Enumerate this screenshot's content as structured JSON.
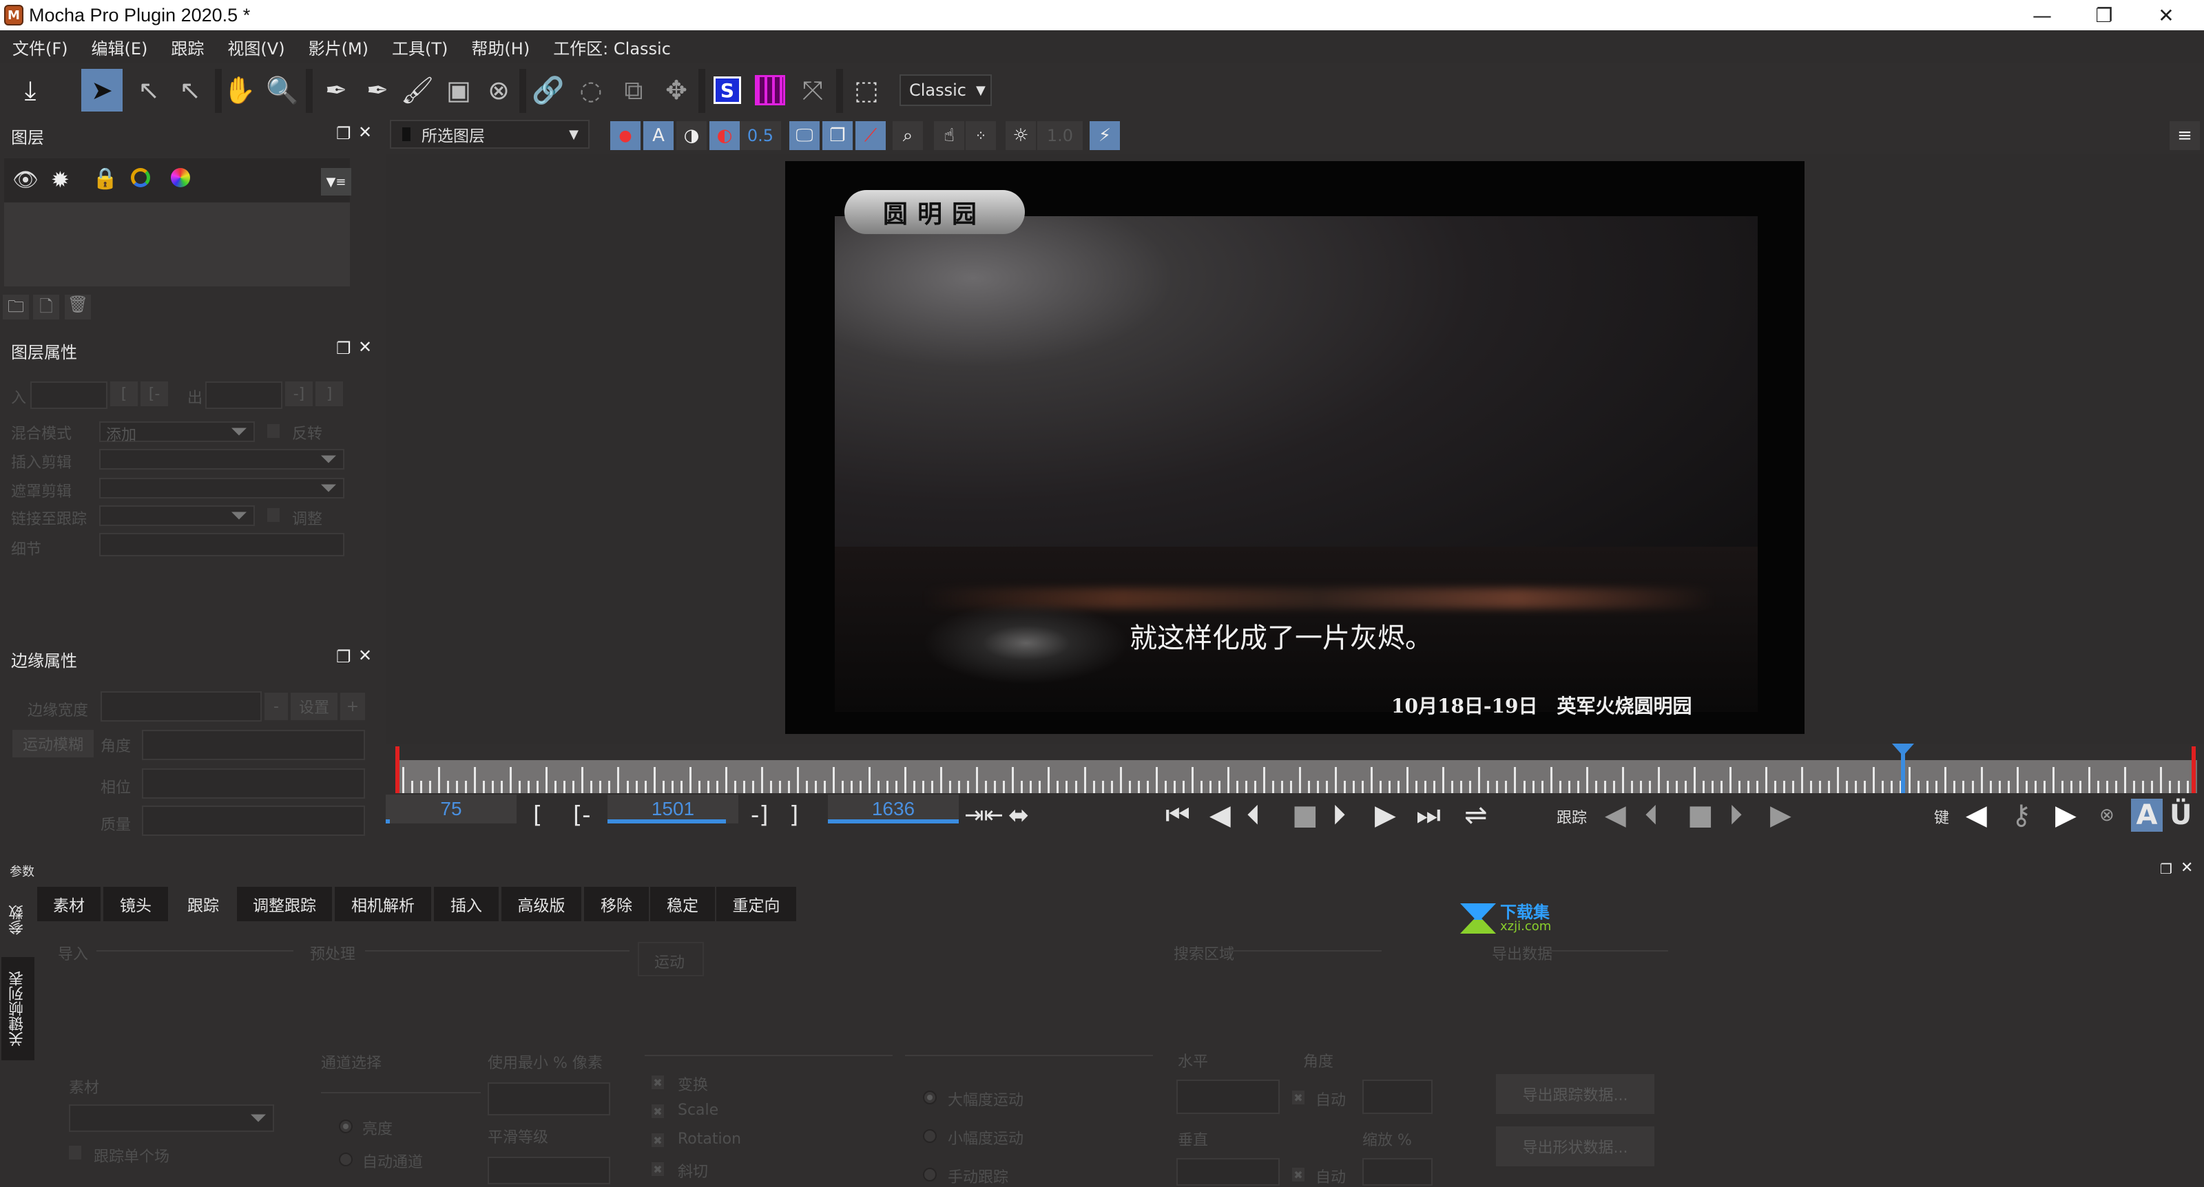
{
  "window": {
    "title": "Mocha Pro Plugin 2020.5 *",
    "logo_letter": "M",
    "minimize": "—",
    "restore": "❐",
    "close": "✕"
  },
  "menu": [
    "文件(F)",
    "编辑(E)",
    "跟踪",
    "视图(V)",
    "影片(M)",
    "工具(T)",
    "帮助(H)",
    "工作区: Classic"
  ],
  "toolbar": {
    "workspace_dropdown": "Classic",
    "tools": [
      {
        "name": "import-icon",
        "glyph": "⤓"
      },
      {
        "name": "select-pointer-icon",
        "glyph": "➤",
        "active": true
      },
      {
        "name": "select-bezier-icon",
        "glyph": "↖"
      },
      {
        "name": "add-point-icon",
        "glyph": "↖"
      },
      {
        "name": "pan-hand-icon",
        "glyph": "✋"
      },
      {
        "name": "zoom-icon",
        "glyph": "🔍"
      },
      {
        "name": "pen-xspline-icon",
        "glyph": "✒"
      },
      {
        "name": "pen-magnetic-icon",
        "glyph": "✒"
      },
      {
        "name": "brush-icon",
        "glyph": "🖌"
      },
      {
        "name": "rect-xspline-icon",
        "glyph": "▣"
      },
      {
        "name": "ellipse-xspline-icon",
        "glyph": "⊗"
      },
      {
        "name": "link-icon",
        "glyph": "🔗"
      },
      {
        "name": "rotate-icon",
        "glyph": "◌"
      },
      {
        "name": "scale-icon",
        "glyph": "⧉"
      },
      {
        "name": "move-icon",
        "glyph": "✥"
      },
      {
        "name": "surface-icon",
        "glyph": "S"
      },
      {
        "name": "grid-icon",
        "glyph": "▦"
      },
      {
        "name": "align-surface-icon",
        "glyph": "⤧"
      },
      {
        "name": "select-region-icon",
        "glyph": "⬚"
      }
    ]
  },
  "viewer_toolbar": {
    "layer_select": "所选图层",
    "opacity": "0.5",
    "brightness": "1.0"
  },
  "layers_panel": {
    "title": "图层",
    "menu_icon": "▼≡"
  },
  "layer_props": {
    "title": "图层属性",
    "in_label": "入",
    "out_label": "出",
    "blend_label": "混合模式",
    "blend_value": "添加",
    "invert_label": "反转",
    "insert_clip_label": "插入剪辑",
    "matte_clip_label": "遮罩剪辑",
    "link_track_label": "链接至跟踪",
    "adjust_label": "调整",
    "detail_label": "细节"
  },
  "edge_props": {
    "title": "边缘属性",
    "width_label": "边缘宽度",
    "minus": "-",
    "set": "设置",
    "plus": "+",
    "motion_blur": "运动模糊",
    "angle_label": "角度",
    "phase_label": "相位",
    "quality_label": "质量"
  },
  "frame": {
    "badge": "圆明园",
    "subtitle": "就这样化成了一片灰烬。",
    "caption": "10月18日-19日　英军火烧圆明园"
  },
  "timeline": {
    "current_frame": "75",
    "in_point": "1501",
    "out_point": "1636",
    "playhead_fraction": 0.838,
    "bracket_in": "[",
    "bracket_in2": "[-",
    "bracket_out2": "-]",
    "bracket_out": "]",
    "track_label": "跟踪",
    "key_label": "键"
  },
  "params": {
    "panel_title": "参数",
    "side_tabs": [
      "参数",
      "关键帧列表"
    ],
    "tabs": [
      "素材",
      "镜头",
      "跟踪",
      "调整跟踪",
      "相机解析",
      "插入",
      "高级版",
      "移除",
      "稳定",
      "重定向"
    ],
    "active_tab": 2,
    "input_section": "导入",
    "clip_label": "素材",
    "track_single_field": "跟踪单个场",
    "preprocess_section": "预处理",
    "channel_label": "通道选择",
    "channel_luminance": "亮度",
    "channel_auto": "自动通道",
    "min_pixels_label": "使用最小 % 像素",
    "smoothing_label": "平滑等级",
    "motion_section": "运动",
    "motion_checks": [
      "变换",
      "Scale",
      "Rotation",
      "斜切"
    ],
    "motion_radios": [
      "大幅度运动",
      "小幅度运动",
      "手动跟踪"
    ],
    "search_section": "搜索区域",
    "horizontal_label": "水平",
    "vertical_label": "垂直",
    "auto_label": "自动",
    "angle_label": "角度",
    "zoom_label": "缩放 %",
    "export_section": "导出数据",
    "export_track": "导出跟踪数据...",
    "export_shape": "导出形状数据..."
  },
  "watermark": {
    "cn": "下载集",
    "url": "xzji.com"
  },
  "colors": {
    "accent": "#5f84b3",
    "value_blue": "#4a90e0",
    "playhead": "#3a8ce0",
    "in_out": "#e02020",
    "bg": "#302e2e"
  }
}
